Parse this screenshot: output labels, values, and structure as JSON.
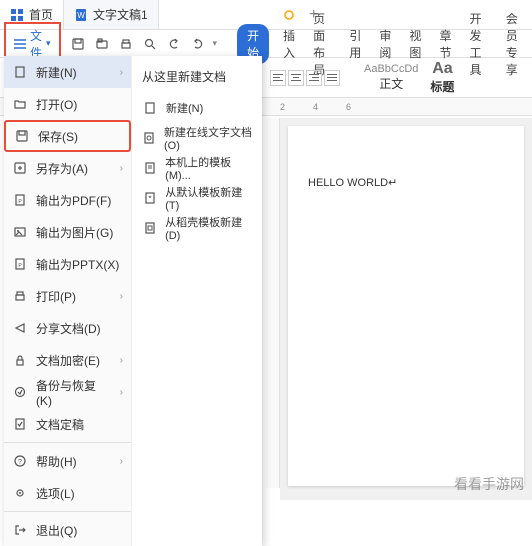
{
  "tabs": {
    "home": "首页",
    "doc": "文字文稿1",
    "add": "+"
  },
  "file_button": "文件",
  "ribbon": {
    "start": "开始",
    "insert": "插入",
    "layout": "页面布局",
    "reference": "引用",
    "review": "审阅",
    "view": "视图",
    "section": "章节",
    "developer": "开发工具",
    "member": "会员专享"
  },
  "styles": {
    "sample": "AaBbCcDd",
    "body_label": "正文",
    "heading_sample": "Aa",
    "heading_label": "标题"
  },
  "ruler_marks": [
    "2",
    "4",
    "6"
  ],
  "file_menu": {
    "new": "新建(N)",
    "open": "打开(O)",
    "save": "保存(S)",
    "save_as": "另存为(A)",
    "export_pdf": "输出为PDF(F)",
    "export_image": "输出为图片(G)",
    "export_pptx": "输出为PPTX(X)",
    "print": "打印(P)",
    "share": "分享文档(D)",
    "encrypt": "文档加密(E)",
    "backup": "备份与恢复(K)",
    "finalize": "文档定稿",
    "help": "帮助(H)",
    "options": "选项(L)",
    "exit": "退出(Q)"
  },
  "submenu": {
    "title": "从这里新建文档",
    "new_doc": "新建(N)",
    "new_online": "新建在线文字文档(O)",
    "local_template": "本机上的模板(M)...",
    "default_template": "从默认模板新建(T)",
    "shell_template": "从稻壳模板新建(D)"
  },
  "document": {
    "content": "HELLO WORLD↵"
  },
  "watermark": "看看手游网"
}
